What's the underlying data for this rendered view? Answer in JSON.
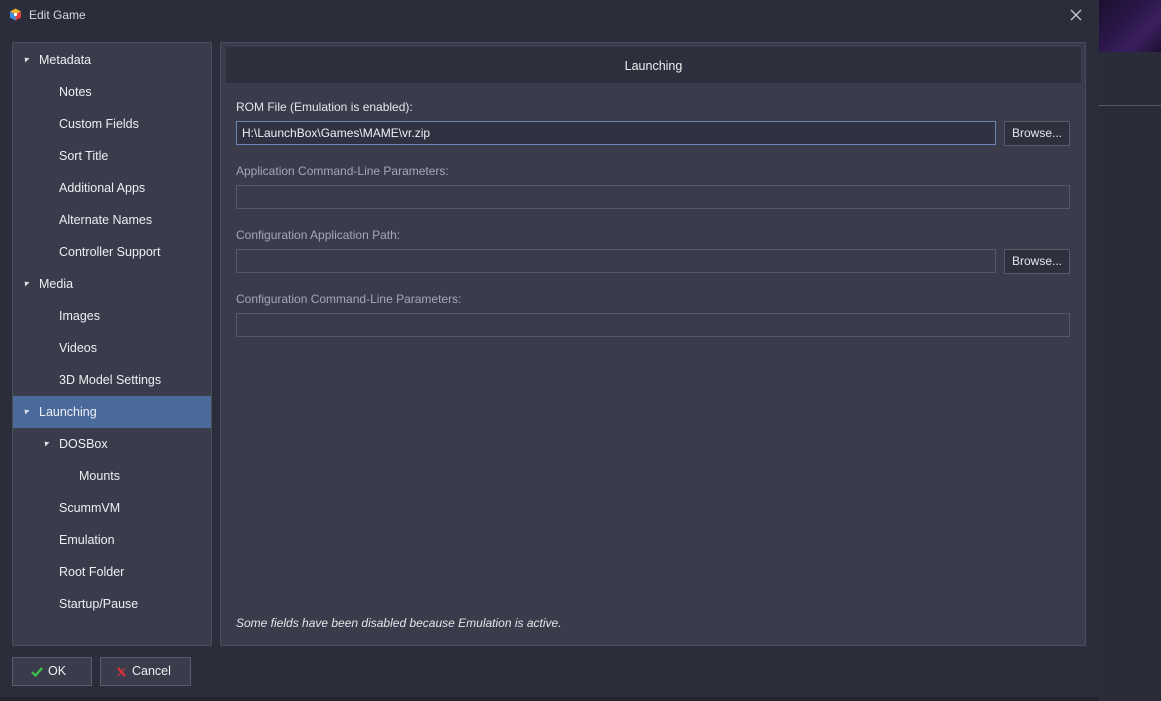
{
  "window": {
    "title": "Edit Game",
    "icon": "launchbox-logo-icon",
    "close_icon": "close-icon"
  },
  "sidebar": {
    "items": [
      {
        "label": "Metadata",
        "level": 0,
        "expanded": true
      },
      {
        "label": "Notes",
        "level": 1
      },
      {
        "label": "Custom Fields",
        "level": 1
      },
      {
        "label": "Sort Title",
        "level": 1
      },
      {
        "label": "Additional Apps",
        "level": 1
      },
      {
        "label": "Alternate Names",
        "level": 1
      },
      {
        "label": "Controller Support",
        "level": 1
      },
      {
        "label": "Media",
        "level": 0,
        "expanded": true
      },
      {
        "label": "Images",
        "level": 1
      },
      {
        "label": "Videos",
        "level": 1
      },
      {
        "label": "3D Model Settings",
        "level": 1
      },
      {
        "label": "Launching",
        "level": 0,
        "expanded": true,
        "selected": true
      },
      {
        "label": "DOSBox",
        "level": 1,
        "expanded": true
      },
      {
        "label": "Mounts",
        "level": 2
      },
      {
        "label": "ScummVM",
        "level": 1
      },
      {
        "label": "Emulation",
        "level": 1
      },
      {
        "label": "Root Folder",
        "level": 1
      },
      {
        "label": "Startup/Pause",
        "level": 1
      }
    ]
  },
  "main": {
    "header": "Launching",
    "rom_file": {
      "label": "ROM File (Emulation is enabled):",
      "value": "H:\\LaunchBox\\Games\\MAME\\vr.zip",
      "browse_label": "Browse..."
    },
    "app_params": {
      "label": "Application Command-Line Parameters:",
      "value": ""
    },
    "config_path": {
      "label": "Configuration Application Path:",
      "value": "",
      "browse_label": "Browse..."
    },
    "config_params": {
      "label": "Configuration Command-Line Parameters:",
      "value": ""
    },
    "note": "Some fields have been disabled because Emulation is active."
  },
  "footer": {
    "ok_label": "OK",
    "ok_icon": "checkmark-icon",
    "cancel_label": "Cancel",
    "cancel_icon": "x-icon"
  },
  "colors": {
    "background": "#2b2d3a",
    "panel": "#3a3c4c",
    "selected": "#4a6a9c",
    "ok_icon": "#3fc24a",
    "cancel_icon": "#d8303a"
  }
}
